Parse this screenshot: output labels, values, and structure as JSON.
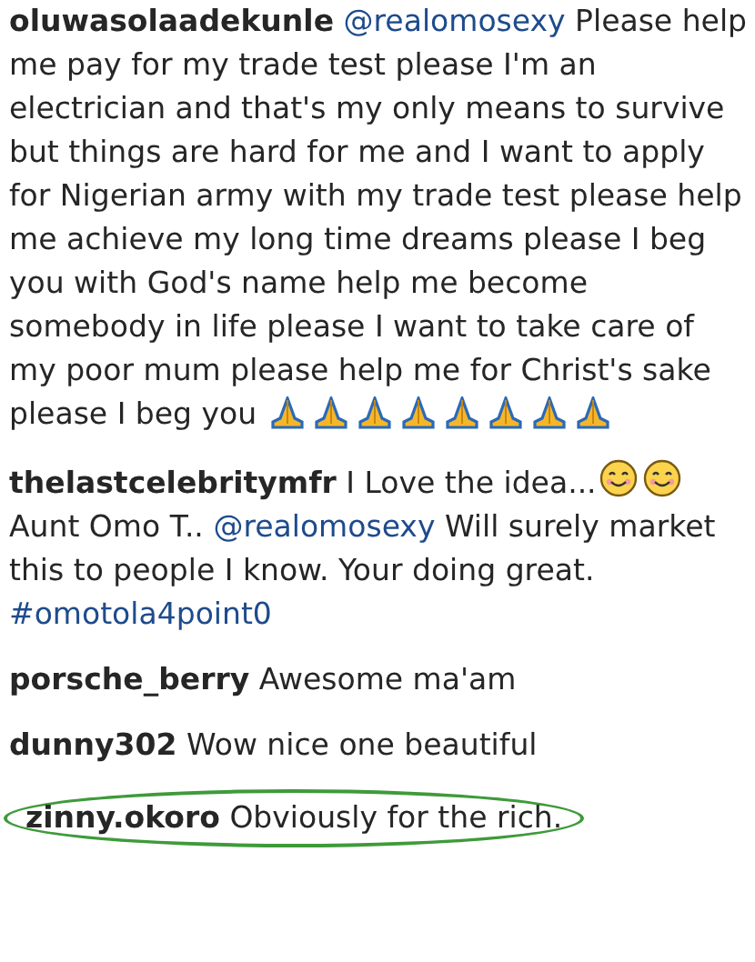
{
  "comments": [
    {
      "username": "oluwasolaadekunle",
      "highlighted": false,
      "parts": [
        {
          "kind": "mention",
          "text": "@realomosexy"
        },
        {
          "kind": "text",
          "text": " Please help me pay for my trade test please I'm an electrician and that's my only means to survive but things are hard for me and I want to apply for Nigerian army with my trade test please help me achieve my long time dreams please I beg you with God's name help me become somebody in life please I want to take care of my poor mum please help me for Christ's sake please I beg you "
        },
        {
          "kind": "pray"
        },
        {
          "kind": "pray"
        },
        {
          "kind": "pray"
        },
        {
          "kind": "pray"
        },
        {
          "kind": "pray"
        },
        {
          "kind": "pray"
        },
        {
          "kind": "pray"
        },
        {
          "kind": "pray"
        }
      ]
    },
    {
      "username": "thelastcelebritymfr",
      "highlighted": false,
      "parts": [
        {
          "kind": "text",
          "text": "I Love the idea..."
        },
        {
          "kind": "smile"
        },
        {
          "kind": "smile"
        },
        {
          "kind": "text",
          "text": " Aunt Omo T.. "
        },
        {
          "kind": "mention",
          "text": "@realomosexy"
        },
        {
          "kind": "text",
          "text": " Will surely market this to people I know. Your doing great. "
        },
        {
          "kind": "mention",
          "text": "#omotola4point0"
        }
      ]
    },
    {
      "username": "porsche_berry",
      "highlighted": false,
      "parts": [
        {
          "kind": "text",
          "text": "Awesome ma'am"
        }
      ]
    },
    {
      "username": "dunny302",
      "highlighted": false,
      "parts": [
        {
          "kind": "text",
          "text": "Wow nice one beautiful"
        }
      ]
    },
    {
      "username": "zinny.okoro",
      "highlighted": true,
      "parts": [
        {
          "kind": "text",
          "text": "Obviously for the rich."
        }
      ]
    }
  ]
}
